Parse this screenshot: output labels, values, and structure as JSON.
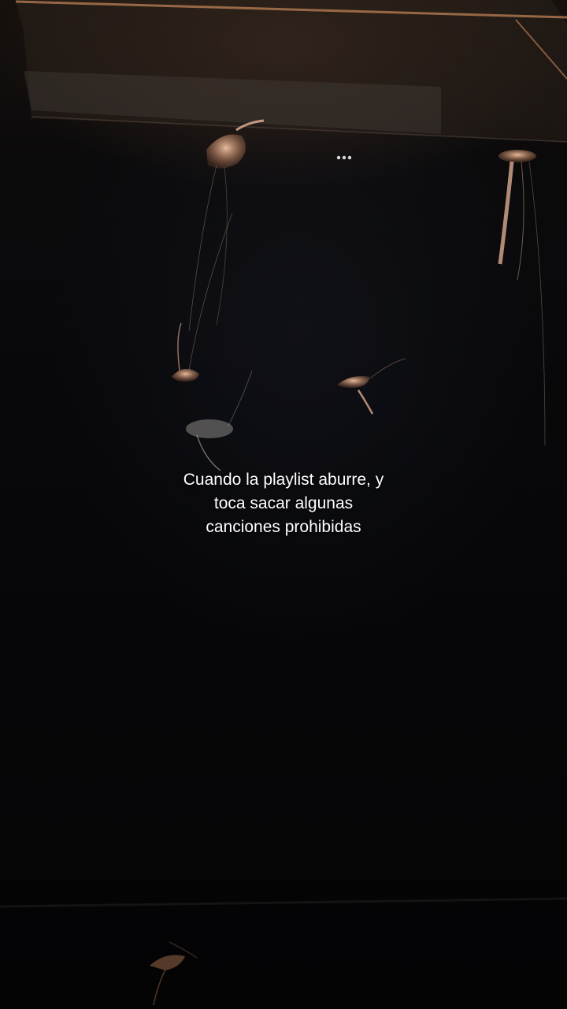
{
  "caption": {
    "line1": "Cuando la playlist aburre, y",
    "line2": "toca sacar algunas",
    "line3": "canciones prohibidas"
  },
  "colors": {
    "background": "#050507",
    "tank_glow": "#c8875a",
    "jellyfish": "#e8b79a",
    "caption_text": "#ffffff"
  }
}
